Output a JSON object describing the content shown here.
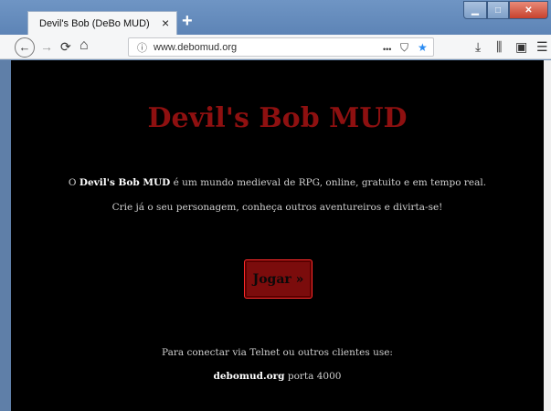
{
  "browser": {
    "tab_title": "Devil's Bob (DeBo MUD)",
    "tab_close": "×",
    "new_tab": "+",
    "url": "www.debomud.org",
    "page_actions": "•••"
  },
  "icons": {
    "back": "←",
    "forward": "→",
    "reload": "⟳",
    "home": "⌂",
    "info": "ⓘ",
    "pocket": "⛉",
    "bookmark": "★",
    "download": "⤓",
    "library": "⫼",
    "sidebar": "▣",
    "menu": "☰",
    "minimize": "▁",
    "maximize": "□",
    "close": "✕"
  },
  "page": {
    "title": "Devil's Bob MUD",
    "intro_prefix": "O ",
    "intro_bold": "Devil's Bob MUD",
    "intro_suffix": " é um mundo medieval de RPG, online, gratuito e em tempo real.",
    "call_to_action": "Crie já o seu personagem, conheça outros aventureiros e divirta-se!",
    "play_button": "Jogar »",
    "telnet_text": "Para conectar via Telnet ou outros clientes use:",
    "telnet_host": "debomud.org",
    "telnet_port_text": " porta 4000"
  },
  "colors": {
    "background": "#000000",
    "title": "#8e1010",
    "button_bg": "#7b0c0c",
    "button_border": "#ff2b2b"
  }
}
